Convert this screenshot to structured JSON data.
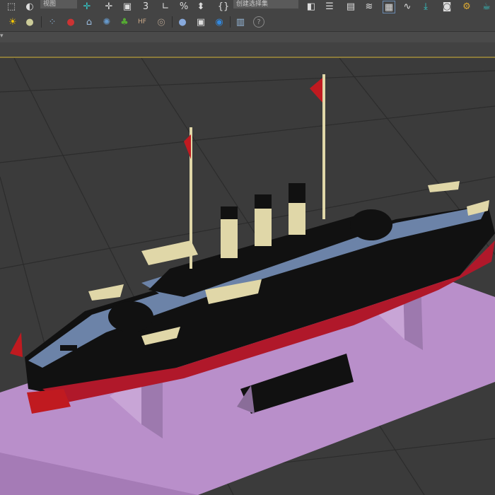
{
  "toolbar": {
    "view_dropdown": "视图",
    "selection_set_dropdown": "创建选择集",
    "snap_label": "3",
    "percent_label": "%"
  },
  "row3": {
    "dropdown_arrow": "▾"
  },
  "colors": {
    "hull": "#111111",
    "deck": "#6c83a8",
    "waterline": "#b0182a",
    "stand": "#b98fca",
    "fittings": "#e0d7a8",
    "accent": "#8a7a3a"
  }
}
